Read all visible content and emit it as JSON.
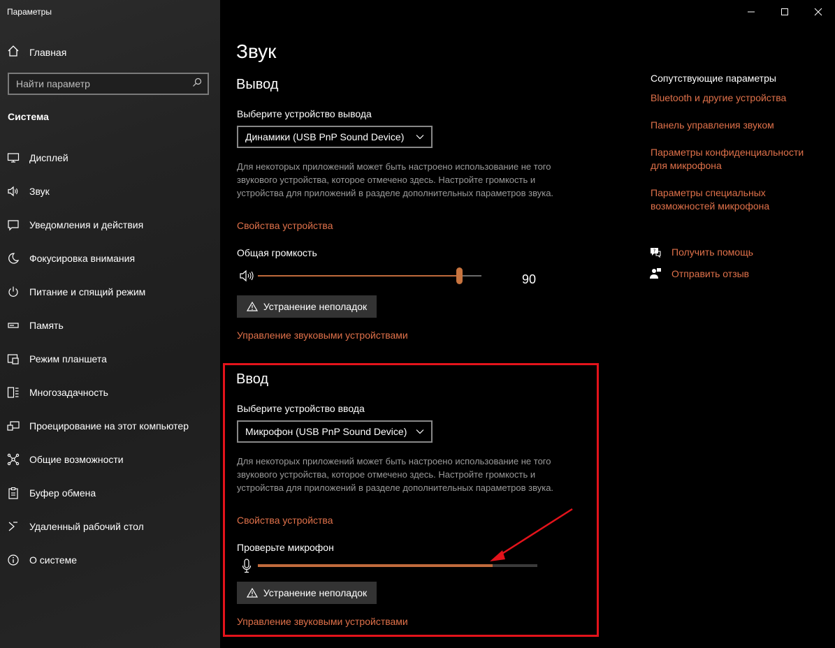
{
  "app": {
    "title": "Параметры"
  },
  "sidebar": {
    "home_label": "Главная",
    "search_placeholder": "Найти параметр",
    "section_title": "Система",
    "items": [
      {
        "label": "Дисплей",
        "icon": "display-icon"
      },
      {
        "label": "Звук",
        "icon": "speaker-icon"
      },
      {
        "label": "Уведомления и действия",
        "icon": "notification-icon"
      },
      {
        "label": "Фокусировка внимания",
        "icon": "moon-icon"
      },
      {
        "label": "Питание и спящий режим",
        "icon": "power-icon"
      },
      {
        "label": "Память",
        "icon": "storage-icon"
      },
      {
        "label": "Режим планшета",
        "icon": "tablet-icon"
      },
      {
        "label": "Многозадачность",
        "icon": "multitask-icon"
      },
      {
        "label": "Проецирование на этот компьютер",
        "icon": "project-icon"
      },
      {
        "label": "Общие возможности",
        "icon": "shared-icon"
      },
      {
        "label": "Буфер обмена",
        "icon": "clipboard-icon"
      },
      {
        "label": "Удаленный рабочий стол",
        "icon": "remote-icon"
      },
      {
        "label": "О системе",
        "icon": "info-icon"
      }
    ]
  },
  "main": {
    "title": "Звук",
    "output": {
      "heading": "Вывод",
      "device_label": "Выберите устройство вывода",
      "device_value": "Динамики (USB PnP Sound Device)",
      "description": "Для некоторых приложений может быть настроено использование не того звукового устройства, которое отмечено здесь. Настройте громкость и устройства для приложений в разделе дополнительных параметров звука.",
      "properties_link": "Свойства устройства",
      "volume_label": "Общая громкость",
      "volume_value": "90",
      "volume_level": 90,
      "troubleshoot_label": "Устранение неполадок",
      "manage_link": "Управление звуковыми устройствами"
    },
    "input": {
      "heading": "Ввод",
      "device_label": "Выберите устройство ввода",
      "device_value": "Микрофон (USB PnP Sound Device)",
      "description": "Для некоторых приложений может быть настроено использование не того звукового устройства, которое отмечено здесь. Настройте громкость и устройства для приложений в разделе дополнительных параметров звука.",
      "properties_link": "Свойства устройства",
      "mic_test_label": "Проверьте микрофон",
      "mic_level": 84,
      "troubleshoot_label": "Устранение неполадок",
      "manage_link": "Управление звуковыми устройствами"
    }
  },
  "related": {
    "title": "Сопутствующие параметры",
    "links": [
      "Bluetooth и другие устройства",
      "Панель управления звуком",
      "Параметры конфиденциальности для микрофона",
      "Параметры специальных возможностей микрофона"
    ],
    "help_label": "Получить помощь",
    "feedback_label": "Отправить отзыв"
  },
  "colors": {
    "accent": "#e0714a",
    "slider_fill": "#c06a3c",
    "highlight": "#e3131b"
  }
}
